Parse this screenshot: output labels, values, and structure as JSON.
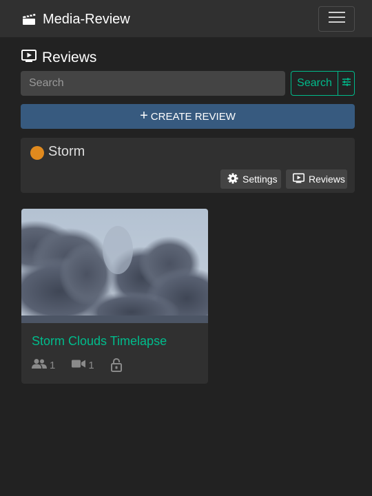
{
  "navbar": {
    "brand": "Media-Review",
    "brand_icon": "clapperboard-icon",
    "menu_icon": "hamburger-icon"
  },
  "page": {
    "heading": "Reviews",
    "heading_icon": "play-screen-icon"
  },
  "search": {
    "placeholder": "Search",
    "value": "",
    "button_label": "Search",
    "filter_icon": "sliders-icon"
  },
  "actions": {
    "create_label": "CREATE REVIEW",
    "create_icon": "plus-icon"
  },
  "project": {
    "name": "Storm",
    "status_color": "#e08a1e",
    "settings_label": "Settings",
    "reviews_label": "Reviews"
  },
  "media": [
    {
      "title": "Storm Clouds Timelapse",
      "members": "1",
      "videos": "1",
      "lock_icon": "lock-open-icon"
    }
  ],
  "colors": {
    "accent": "#00bc8c",
    "primary": "#375a7f",
    "background": "#222222",
    "surface": "#303030"
  }
}
